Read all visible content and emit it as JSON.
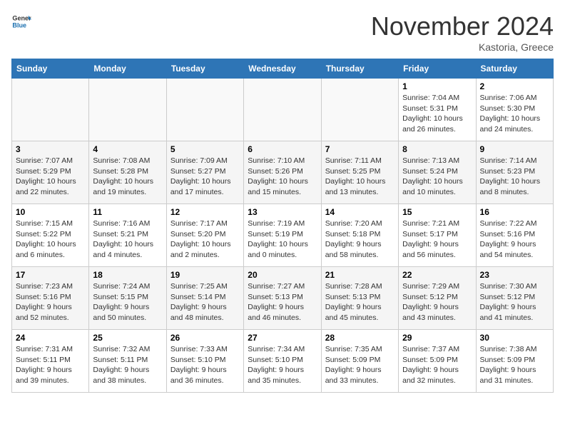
{
  "header": {
    "logo_line1": "General",
    "logo_line2": "Blue",
    "month_title": "November 2024",
    "subtitle": "Kastoria, Greece"
  },
  "weekdays": [
    "Sunday",
    "Monday",
    "Tuesday",
    "Wednesday",
    "Thursday",
    "Friday",
    "Saturday"
  ],
  "weeks": [
    [
      {
        "day": "",
        "info": ""
      },
      {
        "day": "",
        "info": ""
      },
      {
        "day": "",
        "info": ""
      },
      {
        "day": "",
        "info": ""
      },
      {
        "day": "",
        "info": ""
      },
      {
        "day": "1",
        "info": "Sunrise: 7:04 AM\nSunset: 5:31 PM\nDaylight: 10 hours and 26 minutes."
      },
      {
        "day": "2",
        "info": "Sunrise: 7:06 AM\nSunset: 5:30 PM\nDaylight: 10 hours and 24 minutes."
      }
    ],
    [
      {
        "day": "3",
        "info": "Sunrise: 7:07 AM\nSunset: 5:29 PM\nDaylight: 10 hours and 22 minutes."
      },
      {
        "day": "4",
        "info": "Sunrise: 7:08 AM\nSunset: 5:28 PM\nDaylight: 10 hours and 19 minutes."
      },
      {
        "day": "5",
        "info": "Sunrise: 7:09 AM\nSunset: 5:27 PM\nDaylight: 10 hours and 17 minutes."
      },
      {
        "day": "6",
        "info": "Sunrise: 7:10 AM\nSunset: 5:26 PM\nDaylight: 10 hours and 15 minutes."
      },
      {
        "day": "7",
        "info": "Sunrise: 7:11 AM\nSunset: 5:25 PM\nDaylight: 10 hours and 13 minutes."
      },
      {
        "day": "8",
        "info": "Sunrise: 7:13 AM\nSunset: 5:24 PM\nDaylight: 10 hours and 10 minutes."
      },
      {
        "day": "9",
        "info": "Sunrise: 7:14 AM\nSunset: 5:23 PM\nDaylight: 10 hours and 8 minutes."
      }
    ],
    [
      {
        "day": "10",
        "info": "Sunrise: 7:15 AM\nSunset: 5:22 PM\nDaylight: 10 hours and 6 minutes."
      },
      {
        "day": "11",
        "info": "Sunrise: 7:16 AM\nSunset: 5:21 PM\nDaylight: 10 hours and 4 minutes."
      },
      {
        "day": "12",
        "info": "Sunrise: 7:17 AM\nSunset: 5:20 PM\nDaylight: 10 hours and 2 minutes."
      },
      {
        "day": "13",
        "info": "Sunrise: 7:19 AM\nSunset: 5:19 PM\nDaylight: 10 hours and 0 minutes."
      },
      {
        "day": "14",
        "info": "Sunrise: 7:20 AM\nSunset: 5:18 PM\nDaylight: 9 hours and 58 minutes."
      },
      {
        "day": "15",
        "info": "Sunrise: 7:21 AM\nSunset: 5:17 PM\nDaylight: 9 hours and 56 minutes."
      },
      {
        "day": "16",
        "info": "Sunrise: 7:22 AM\nSunset: 5:16 PM\nDaylight: 9 hours and 54 minutes."
      }
    ],
    [
      {
        "day": "17",
        "info": "Sunrise: 7:23 AM\nSunset: 5:16 PM\nDaylight: 9 hours and 52 minutes."
      },
      {
        "day": "18",
        "info": "Sunrise: 7:24 AM\nSunset: 5:15 PM\nDaylight: 9 hours and 50 minutes."
      },
      {
        "day": "19",
        "info": "Sunrise: 7:25 AM\nSunset: 5:14 PM\nDaylight: 9 hours and 48 minutes."
      },
      {
        "day": "20",
        "info": "Sunrise: 7:27 AM\nSunset: 5:13 PM\nDaylight: 9 hours and 46 minutes."
      },
      {
        "day": "21",
        "info": "Sunrise: 7:28 AM\nSunset: 5:13 PM\nDaylight: 9 hours and 45 minutes."
      },
      {
        "day": "22",
        "info": "Sunrise: 7:29 AM\nSunset: 5:12 PM\nDaylight: 9 hours and 43 minutes."
      },
      {
        "day": "23",
        "info": "Sunrise: 7:30 AM\nSunset: 5:12 PM\nDaylight: 9 hours and 41 minutes."
      }
    ],
    [
      {
        "day": "24",
        "info": "Sunrise: 7:31 AM\nSunset: 5:11 PM\nDaylight: 9 hours and 39 minutes."
      },
      {
        "day": "25",
        "info": "Sunrise: 7:32 AM\nSunset: 5:11 PM\nDaylight: 9 hours and 38 minutes."
      },
      {
        "day": "26",
        "info": "Sunrise: 7:33 AM\nSunset: 5:10 PM\nDaylight: 9 hours and 36 minutes."
      },
      {
        "day": "27",
        "info": "Sunrise: 7:34 AM\nSunset: 5:10 PM\nDaylight: 9 hours and 35 minutes."
      },
      {
        "day": "28",
        "info": "Sunrise: 7:35 AM\nSunset: 5:09 PM\nDaylight: 9 hours and 33 minutes."
      },
      {
        "day": "29",
        "info": "Sunrise: 7:37 AM\nSunset: 5:09 PM\nDaylight: 9 hours and 32 minutes."
      },
      {
        "day": "30",
        "info": "Sunrise: 7:38 AM\nSunset: 5:09 PM\nDaylight: 9 hours and 31 minutes."
      }
    ]
  ]
}
